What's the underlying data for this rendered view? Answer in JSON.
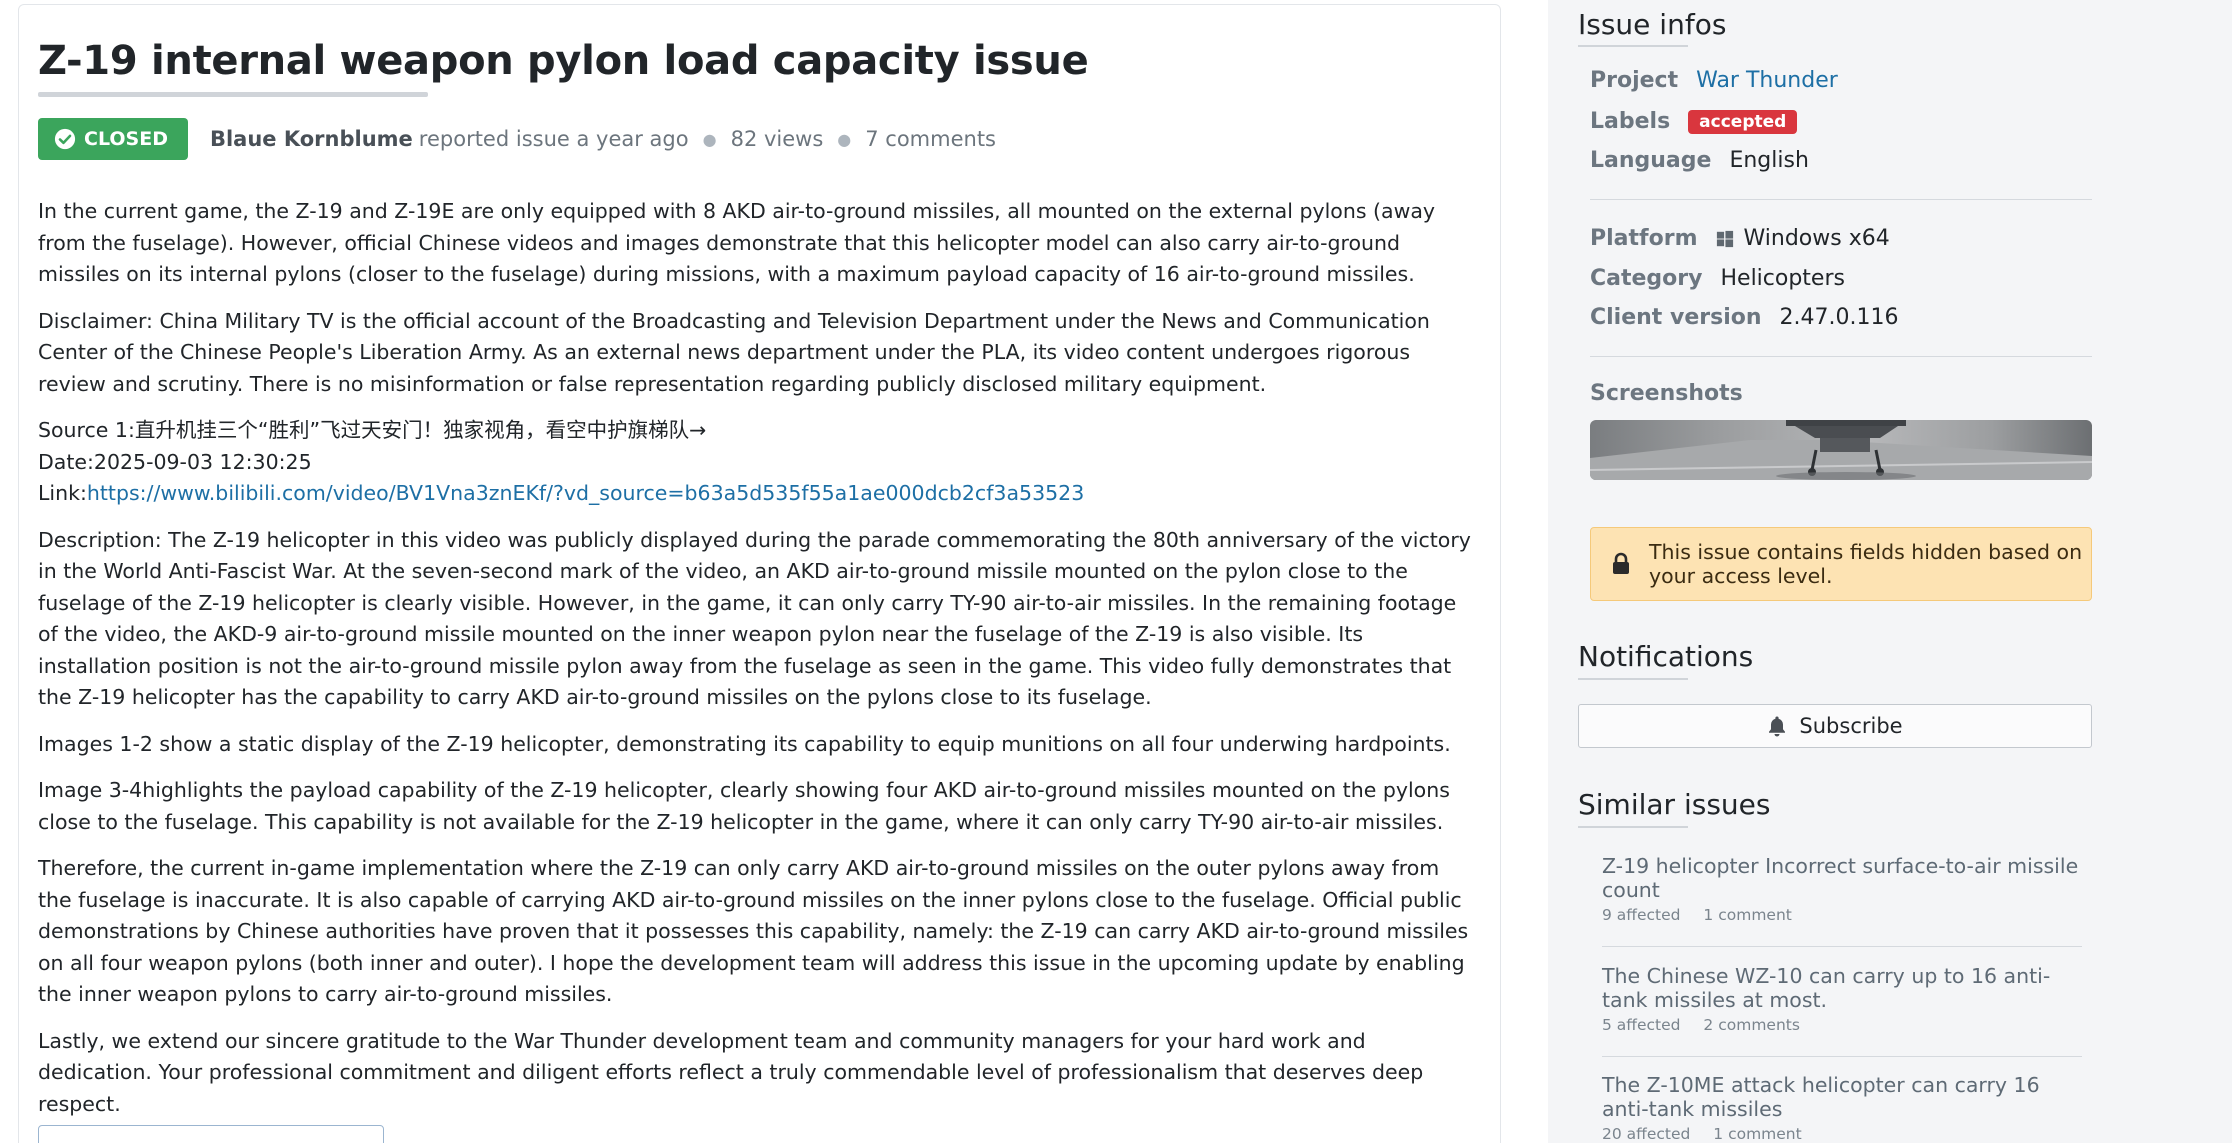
{
  "issue": {
    "title": "Z-19 internal weapon pylon load capacity issue",
    "status": "CLOSED",
    "author": "Blaue Kornblume",
    "reported_text": "reported issue a year ago",
    "views": "82 views",
    "comments": "7 comments"
  },
  "body": {
    "p1": "In the current game, the Z-19 and Z-19E are only equipped with 8 AKD air-to-ground missiles, all mounted on the external pylons (away from the fuselage). However, official Chinese videos and images demonstrate that this helicopter model can also carry air-to-ground missiles on its internal pylons (closer to the fuselage) during missions, with a maximum payload capacity of 16 air-to-ground missiles.",
    "p2": "Disclaimer: China Military TV is the official account of the Broadcasting and Television Department under the News and Communication Center of the Chinese People's Liberation Army. As an external news department under the PLA, its video content undergoes rigorous review and scrutiny. There is no misinformation or false representation regarding publicly disclosed military equipment.",
    "source_line": "Source 1:直升机挂三个“胜利”飞过天安门！独家视角，看空中护旗梯队→",
    "date_line": "Date:2025-09-03 12:30:25",
    "link_prefix": "Link:",
    "link_url": "https://www.bilibili.com/video/BV1Vna3znEKf/?vd_source=b63a5d535f55a1ae000dcb2cf3a53523",
    "p3": "Description: The Z-19 helicopter in this video was publicly displayed during the parade commemorating the 80th anniversary of the victory in the World Anti-Fascist War. At the seven-second mark of the video, an AKD air-to-ground missile mounted on the pylon close to the fuselage of the Z-19 helicopter is clearly visible. However, in the game, it can only carry TY-90 air-to-air missiles. In the remaining footage of the video, the AKD-9 air-to-ground missile mounted on the inner weapon pylon near the fuselage of the Z-19 is also visible. Its installation position is not the air-to-ground missile pylon away from the fuselage as seen in the game. This video fully demonstrates that the Z-19 helicopter has the capability to carry AKD air-to-ground missiles on the pylons close to its fuselage.",
    "p4": "Images 1-2 show a static display of the Z-19 helicopter, demonstrating its capability to equip munitions on all four underwing hardpoints.",
    "p5": "Image 3-4highlights the payload capability of the Z-19 helicopter, clearly showing four AKD air-to-ground missiles mounted on the pylons close to the fuselage. This capability is not available for the Z-19 helicopter in the game, where it can only carry TY-90 air-to-air missiles.",
    "p6": "Therefore, the current in-game implementation where the Z-19 can only carry AKD air-to-ground missiles on the outer pylons away from the fuselage is inaccurate. It is also capable of carrying AKD air-to-ground missiles on the inner pylons close to the fuselage. Official public demonstrations by Chinese authorities have proven that it possesses this capability, namely: the Z-19 can carry AKD air-to-ground missiles on all four weapon pylons (both inner and outer). I hope the development team will address this issue in the upcoming update by enabling the inner weapon pylons to carry air-to-ground missiles.",
    "p7": "Lastly, we extend our sincere gratitude to the War Thunder development team and community managers for your hard work and dedication. Your professional commitment and diligent efforts reflect a truly commendable level of professionalism that deserves deep respect."
  },
  "sidebar": {
    "issue_infos_title": "Issue infos",
    "project_label": "Project",
    "project_value": "War Thunder",
    "labels_label": "Labels",
    "labels_value": "accepted",
    "language_label": "Language",
    "language_value": "English",
    "platform_label": "Platform",
    "platform_value": "Windows x64",
    "category_label": "Category",
    "category_value": "Helicopters",
    "client_label": "Client version",
    "client_value": "2.47.0.116",
    "screenshots_label": "Screenshots",
    "notice_text": "This issue contains fields hidden based on your access level.",
    "notifications_title": "Notifications",
    "subscribe_label": "Subscribe",
    "similar_title": "Similar issues",
    "similar": [
      {
        "title": "Z-19 helicopter Incorrect surface-to-air missile count",
        "affected": "9 affected",
        "comments": "1 comment"
      },
      {
        "title": "The Chinese WZ-10 can carry up to 16 anti-tank missiles at most.",
        "affected": "5 affected",
        "comments": "2 comments"
      },
      {
        "title": "The Z-10ME attack helicopter can carry 16 anti-tank missiles",
        "affected": "20 affected",
        "comments": "1 comment"
      }
    ]
  },
  "colors": {
    "closed_badge": "#3ba55c",
    "label_badge": "#d9363e",
    "link": "#1d6fa5",
    "notice_bg": "#fde3b3"
  }
}
